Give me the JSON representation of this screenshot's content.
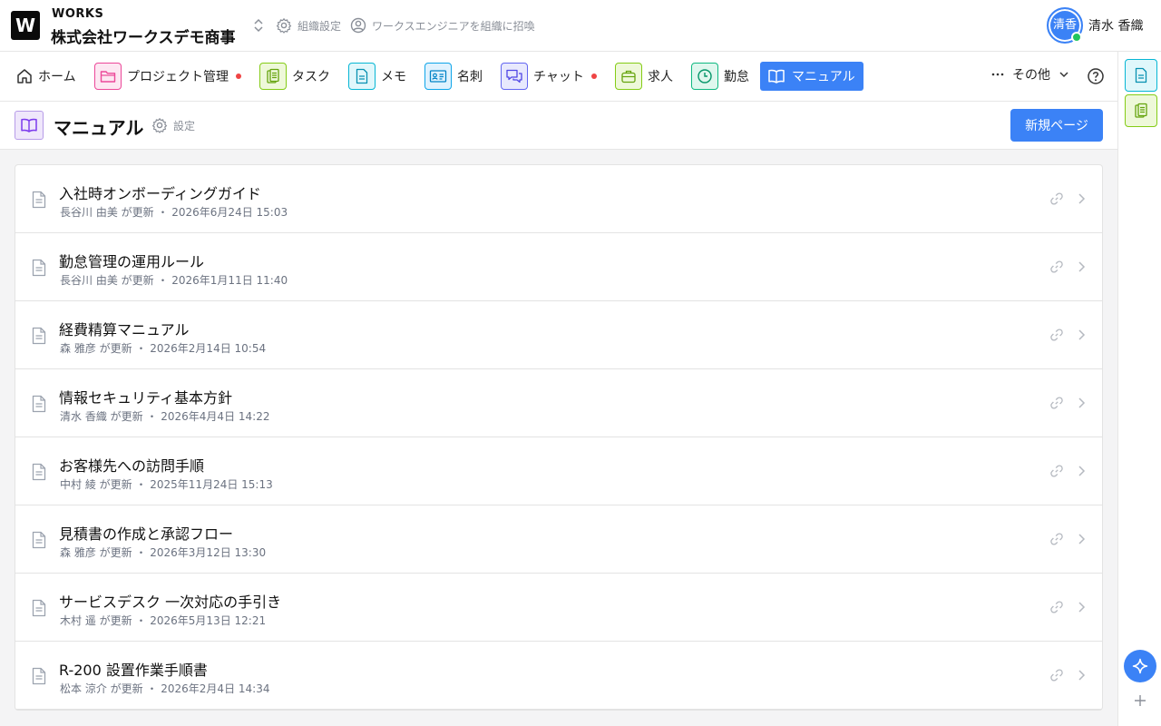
{
  "header": {
    "logo_letter": "W",
    "brand": "WORKS",
    "company": "株式会社ワークスデモ商事",
    "org_settings_label": "組織設定",
    "invite_label": "ワークスエンジニアを組織に招喚",
    "user": {
      "avatar_text": "清香",
      "name": "清水 香織",
      "status": "online"
    }
  },
  "tabs": [
    {
      "label": "ホーム",
      "icon": "home-icon"
    },
    {
      "label": "プロジェクト管理",
      "icon": "folder-icon",
      "color": "#ec4899",
      "notify": true
    },
    {
      "label": "タスク",
      "icon": "clipboard-icon",
      "color": "#84cc16"
    },
    {
      "label": "メモ",
      "icon": "document-icon",
      "color": "#06b6d4"
    },
    {
      "label": "名刺",
      "icon": "id-card-icon",
      "color": "#0ea5e9"
    },
    {
      "label": "チャット",
      "icon": "chat-icon",
      "color": "#6366f1",
      "notify": true
    },
    {
      "label": "求人",
      "icon": "briefcase-icon",
      "color": "#84cc16"
    },
    {
      "label": "勤怠",
      "icon": "clock-icon",
      "color": "#10b981"
    },
    {
      "label": "マニュアル",
      "icon": "book-icon",
      "active": true
    }
  ],
  "more_label": "その他",
  "page": {
    "title": "マニュアル",
    "settings_label": "設定",
    "new_button": "新規ページ"
  },
  "manuals": [
    {
      "title": "入社時オンボーディングガイド",
      "meta": "長谷川 由美 が更新 ・ 2026年6月24日 15:03"
    },
    {
      "title": "勤怠管理の運用ルール",
      "meta": "長谷川 由美 が更新 ・ 2026年1月11日 11:40"
    },
    {
      "title": "経費精算マニュアル",
      "meta": "森 雅彦 が更新 ・ 2026年2月14日 10:54"
    },
    {
      "title": "情報セキュリティ基本方針",
      "meta": "清水 香織 が更新 ・ 2026年4月4日 14:22"
    },
    {
      "title": "お客様先への訪問手順",
      "meta": "中村 綾 が更新 ・ 2025年11月24日 15:13"
    },
    {
      "title": "見積書の作成と承認フロー",
      "meta": "森 雅彦 が更新 ・ 2026年3月12日 13:30"
    },
    {
      "title": "サービスデスク 一次対応の手引き",
      "meta": "木村 遥 が更新 ・ 2026年5月13日 12:21"
    },
    {
      "title": "R-200 設置作業手順書",
      "meta": "松本 涼介 が更新 ・ 2026年2月4日 14:34"
    }
  ],
  "colors": {
    "accent": "#3b82f6",
    "notify": "#ef4444",
    "online": "#22c55e",
    "manual_icon_bg": "#efe7fb"
  }
}
